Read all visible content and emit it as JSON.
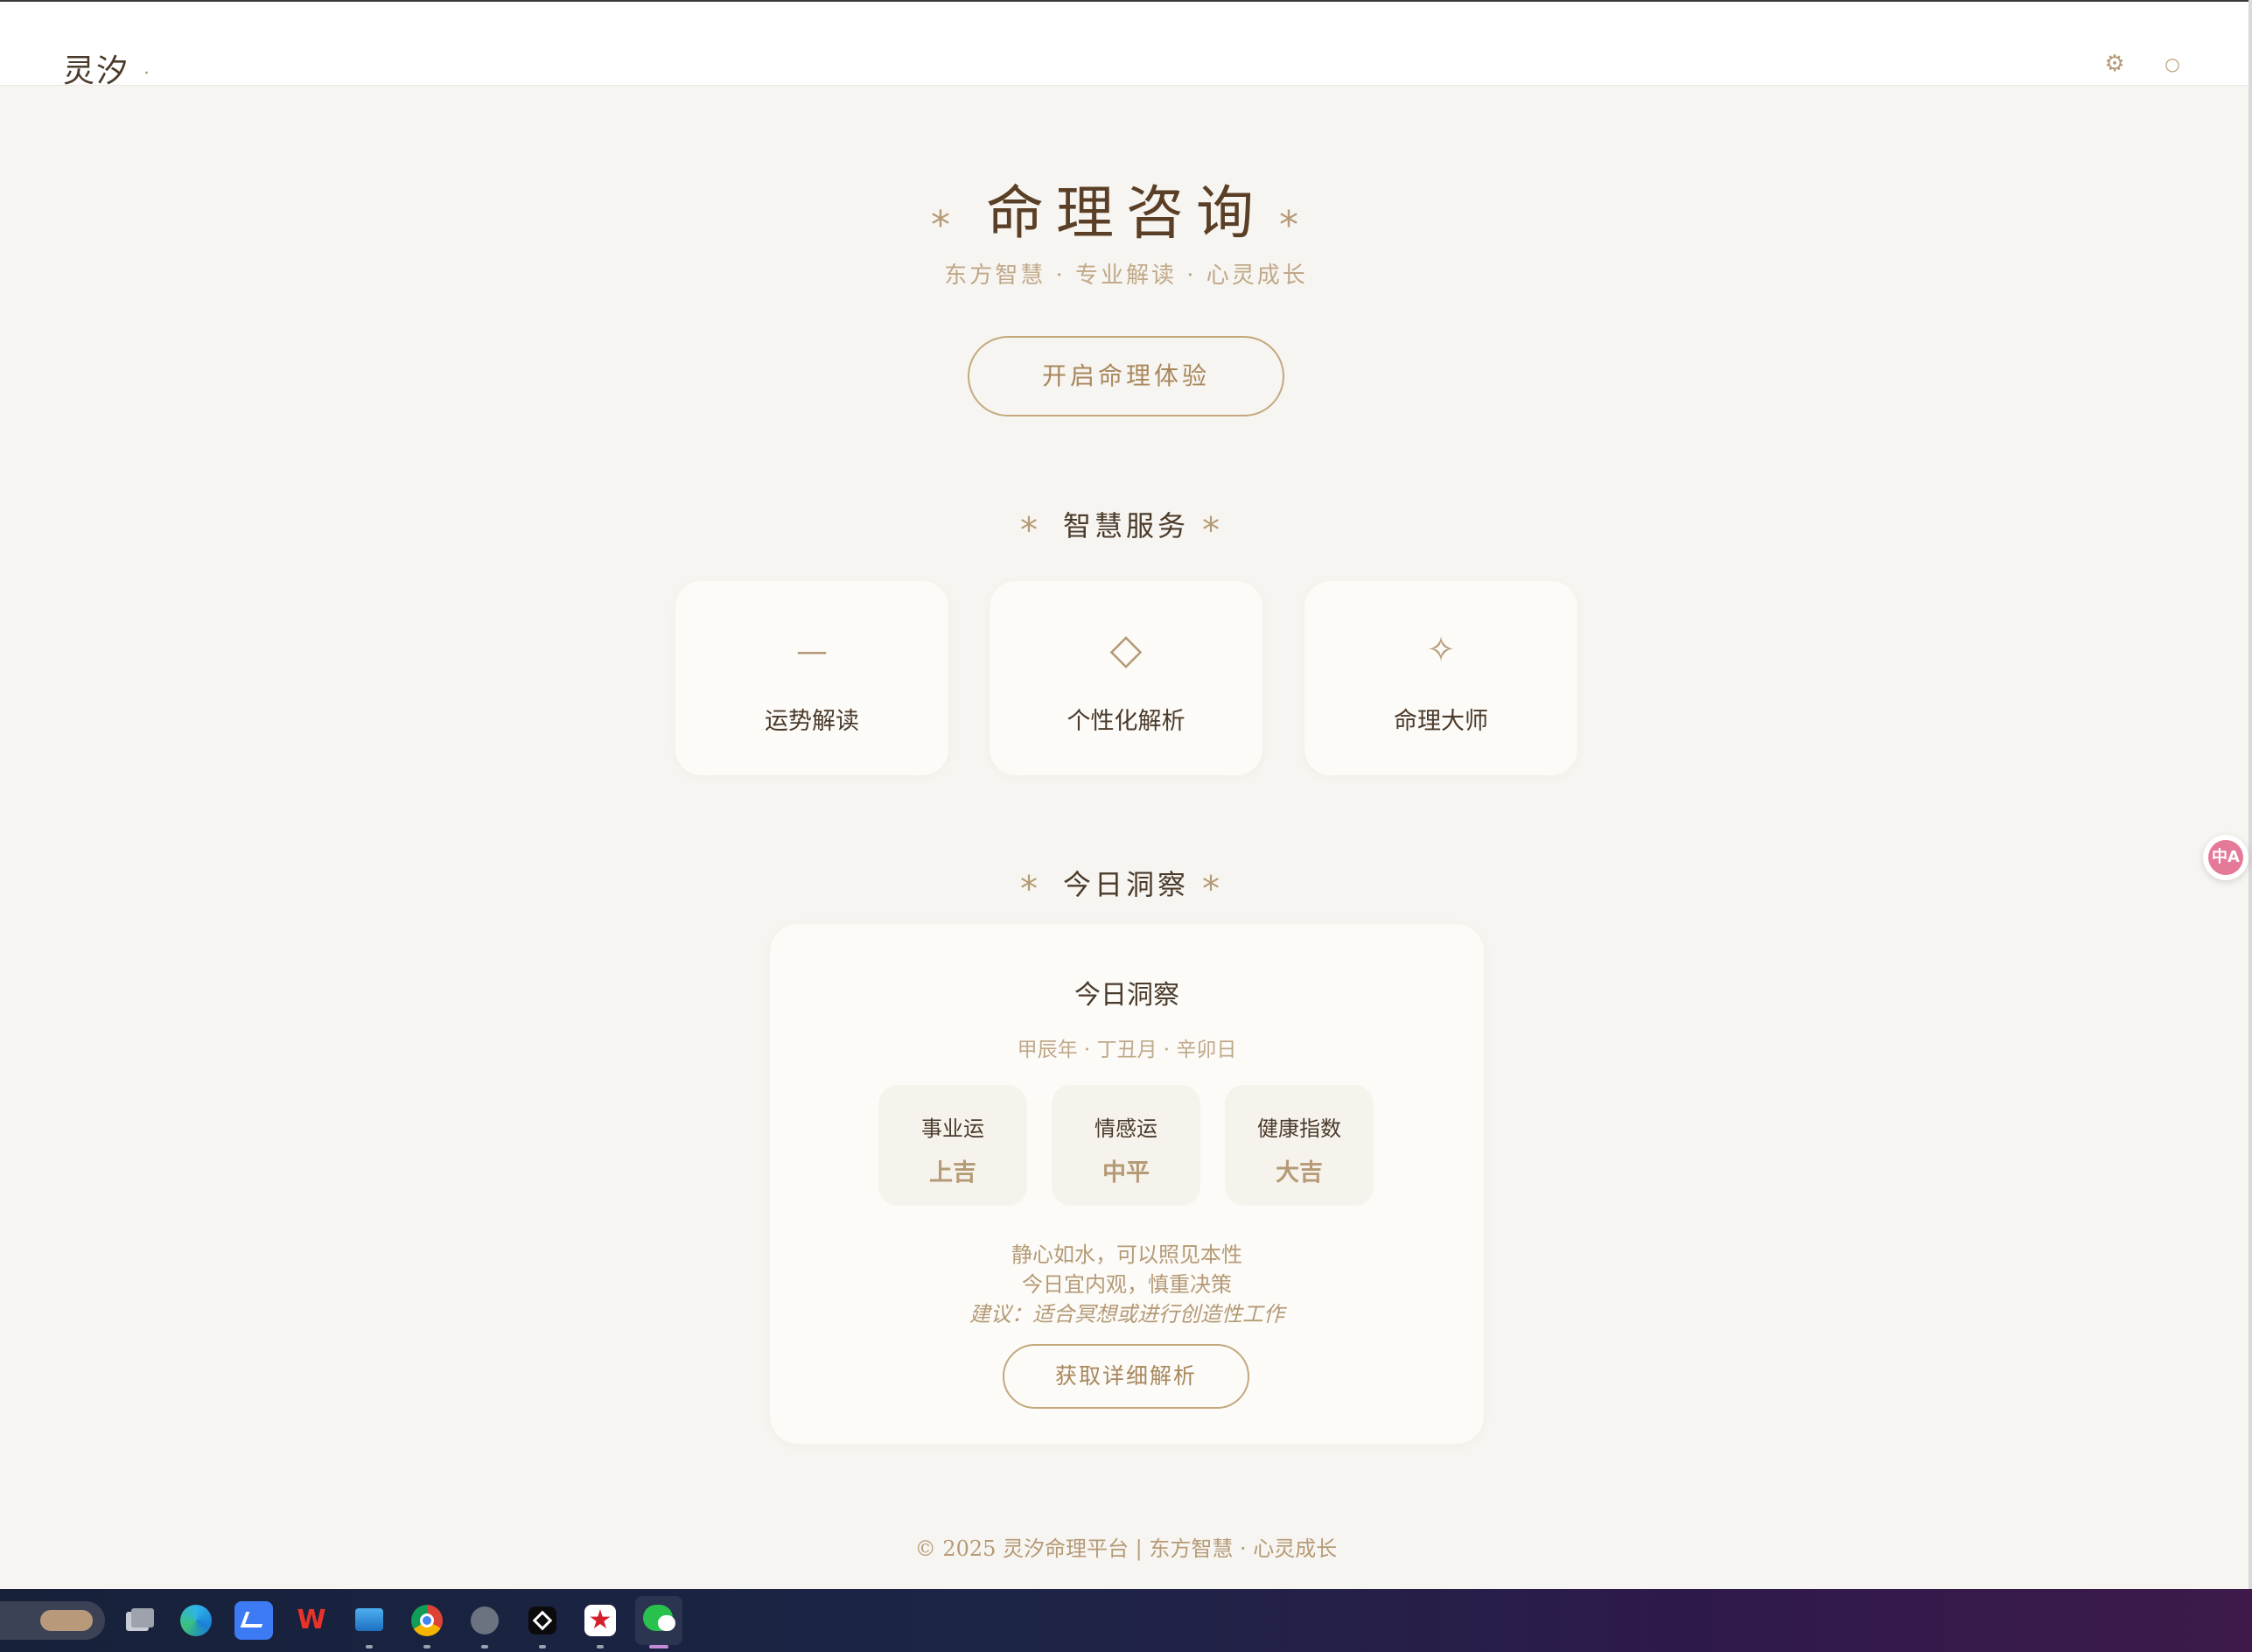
{
  "header": {
    "logo": "灵汐",
    "logo_dot": "·",
    "settings_icon": "⚙",
    "user_icon": "○"
  },
  "hero": {
    "title": "命理咨询",
    "star": "⁎",
    "subtitle": "东方智慧 · 专业解读 · 心灵成长",
    "cta_label": "开启命理体验"
  },
  "services": {
    "title": "智慧服务",
    "items": [
      {
        "icon": "—",
        "label": "运势解读"
      },
      {
        "icon": "◇",
        "label": "个性化解析"
      },
      {
        "icon": "✧",
        "label": "命理大师"
      }
    ]
  },
  "insight": {
    "section_title": "今日洞察",
    "card_title": "今日洞察",
    "date": "甲辰年 · 丁丑月 · 辛卯日",
    "luck": [
      {
        "name": "事业运",
        "value": "上吉"
      },
      {
        "name": "情感运",
        "value": "中平"
      },
      {
        "name": "健康指数",
        "value": "大吉"
      }
    ],
    "line1": "静心如水，可以照见本性",
    "line2": "今日宜内观，慎重决策",
    "advice": "建议：适合冥想或进行创造性工作",
    "detail_button": "获取详细解析"
  },
  "footer": {
    "text": "© 2025 灵汐命理平台 | 东方智慧 · 心灵成长"
  },
  "side_widget": {
    "label": "中A"
  },
  "colors": {
    "accent": "#b59a76",
    "page_bg": "#f7f5f1",
    "card_bg": "#fcfbf8",
    "text_dark": "#4a3a2a"
  },
  "taskbar": {
    "apps": [
      "search-widget",
      "task-view",
      "edge",
      "feishu",
      "wps",
      "photos",
      "chrome",
      "app-icon",
      "capcut",
      "app-red",
      "wechat"
    ]
  }
}
